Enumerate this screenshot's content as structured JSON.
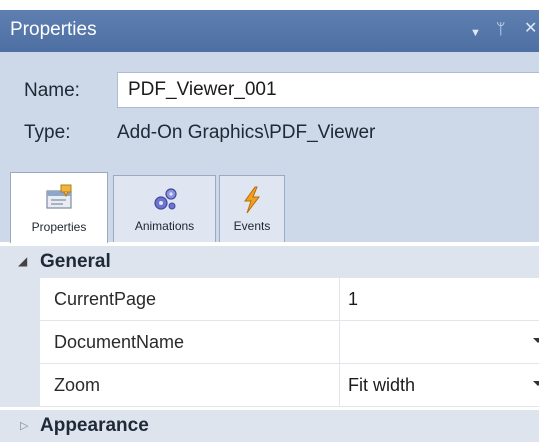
{
  "titlebar": {
    "title": "Properties",
    "dropdown_icon": "dropdown-triangle-icon",
    "pin_icon": "pin-icon",
    "close_icon": "close-icon"
  },
  "header": {
    "name_label": "Name:",
    "name_value": "PDF_Viewer_001",
    "type_label": "Type:",
    "type_value": "Add-On Graphics\\PDF_Viewer"
  },
  "tabs": [
    {
      "label": "Properties",
      "icon": "properties-icon",
      "active": true
    },
    {
      "label": "Animations",
      "icon": "animations-icon",
      "active": false
    },
    {
      "label": "Events",
      "icon": "events-icon",
      "active": false
    }
  ],
  "grid": {
    "general": {
      "label": "General",
      "expanded": true,
      "properties": [
        {
          "name": "CurrentPage",
          "value": "1"
        },
        {
          "name": "DocumentName",
          "value": ""
        },
        {
          "name": "Zoom",
          "value": "Fit width"
        }
      ]
    },
    "appearance": {
      "label": "Appearance",
      "expanded": false
    }
  },
  "colors": {
    "titlebar": "#5a7aae",
    "header": "#cdd8e8",
    "category_band": "#dde4ee"
  }
}
